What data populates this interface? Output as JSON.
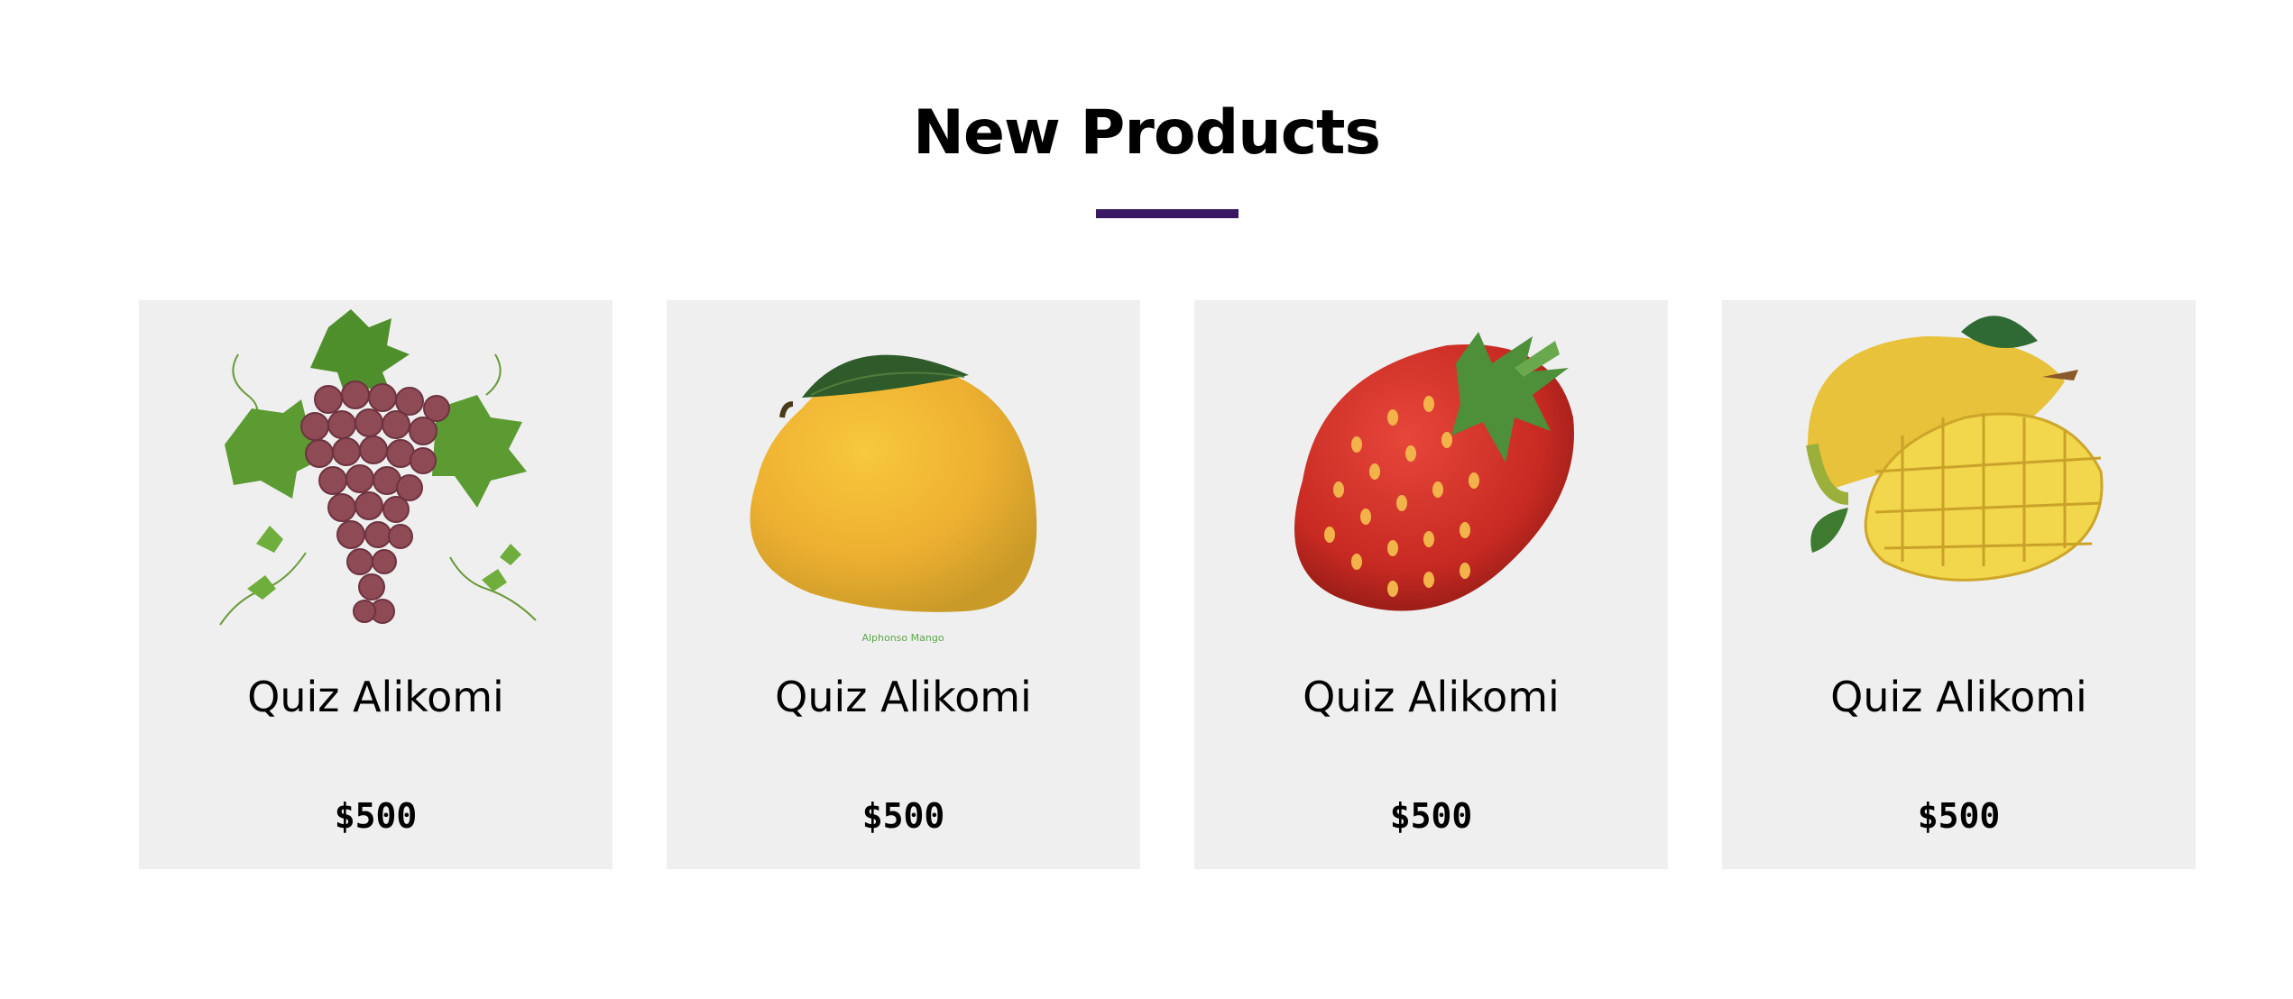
{
  "section": {
    "title": "New Products"
  },
  "products": [
    {
      "name": "Quiz Alikomi",
      "price": "$500",
      "image_icon": "grapes-icon"
    },
    {
      "name": "Quiz Alikomi",
      "price": "$500",
      "image_icon": "mango-icon",
      "image_caption": "Alphonso Mango"
    },
    {
      "name": "Quiz Alikomi",
      "price": "$500",
      "image_icon": "strawberry-icon"
    },
    {
      "name": "Quiz Alikomi",
      "price": "$500",
      "image_icon": "sliced-mango-icon"
    }
  ],
  "colors": {
    "accent": "#3a1763",
    "card_bg": "#efefef"
  }
}
